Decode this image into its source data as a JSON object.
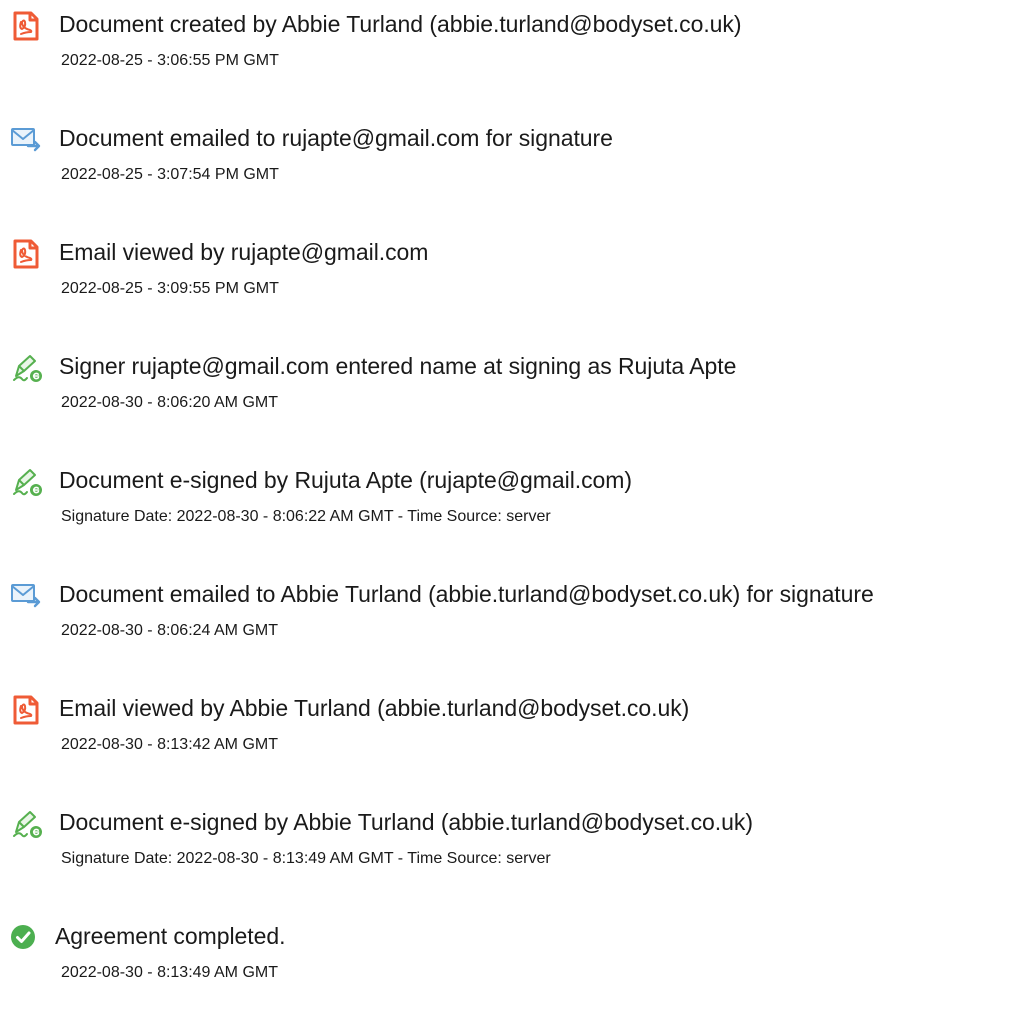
{
  "colors": {
    "doc_icon": "#ef5b36",
    "email_icon": "#5b9bd5",
    "sign_icon": "#56b04f",
    "complete_icon": "#4caf50",
    "text": "#1a1a1a"
  },
  "events": [
    {
      "icon": "document-icon",
      "title": "Document created by Abbie Turland (abbie.turland@bodyset.co.uk)",
      "meta": "2022-08-25 - 3:06:55 PM GMT"
    },
    {
      "icon": "email-sent-icon",
      "title": "Document emailed to rujapte@gmail.com for signature",
      "meta": "2022-08-25 - 3:07:54 PM GMT"
    },
    {
      "icon": "document-icon",
      "title": "Email viewed by rujapte@gmail.com",
      "meta": "2022-08-25 - 3:09:55 PM GMT"
    },
    {
      "icon": "e-sign-pen-icon",
      "title": "Signer rujapte@gmail.com entered name at signing as Rujuta Apte",
      "meta": "2022-08-30 - 8:06:20 AM GMT"
    },
    {
      "icon": "e-sign-pen-icon",
      "title": "Document e-signed by Rujuta Apte (rujapte@gmail.com)",
      "meta": "Signature Date: 2022-08-30 - 8:06:22 AM GMT - Time Source: server"
    },
    {
      "icon": "email-sent-icon",
      "title": "Document emailed to Abbie Turland (abbie.turland@bodyset.co.uk) for signature",
      "meta": "2022-08-30 - 8:06:24 AM GMT"
    },
    {
      "icon": "document-icon",
      "title": "Email viewed by Abbie Turland (abbie.turland@bodyset.co.uk)",
      "meta": "2022-08-30 - 8:13:42 AM GMT"
    },
    {
      "icon": "e-sign-pen-icon",
      "title": "Document e-signed by Abbie Turland (abbie.turland@bodyset.co.uk)",
      "meta": "Signature Date: 2022-08-30 - 8:13:49 AM GMT - Time Source: server"
    },
    {
      "icon": "checkmark-circle-icon",
      "title": "Agreement completed.",
      "meta": "2022-08-30 - 8:13:49 AM GMT"
    }
  ]
}
